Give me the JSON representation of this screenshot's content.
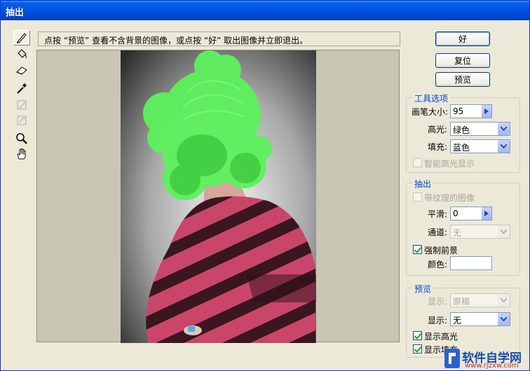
{
  "window": {
    "title": "抽出"
  },
  "hint": "点按 “预览” 查看不含背景的图像，或点按 “好” 取出图像并立即退出。",
  "tools": [
    "edge-highlighter-icon",
    "fill-bucket-icon",
    "eraser-icon",
    "eyedropper-icon",
    "cleanup-icon",
    "edge-touchup-icon",
    "zoom-icon",
    "hand-icon"
  ],
  "buttons": {
    "ok": "好",
    "reset": "复位",
    "preview": "预览"
  },
  "tool_options": {
    "title": "工具选项",
    "brush_size_label": "画笔大小:",
    "brush_size_value": "95",
    "highlight_label": "高光:",
    "highlight_value": "绿色",
    "fill_label": "填充:",
    "fill_value": "蓝色",
    "smart_highlight_label": "智能高光显示"
  },
  "extraction": {
    "title": "抽出",
    "textured_label": "带纹理的图像",
    "smooth_label": "平滑:",
    "smooth_value": "0",
    "channel_label": "通道:",
    "channel_value": "无",
    "force_fg_label": "强制前景",
    "color_label": "颜色:"
  },
  "preview_group": {
    "title": "预览",
    "show_label": "显示:",
    "show_value": "原稿",
    "show2_label": "显示:",
    "show2_value": "无",
    "show_highlight_label": "显示高光",
    "show_fill_label": "显示填充"
  },
  "watermark": {
    "text": "软件自学网",
    "url": "www.rjzxw.com"
  },
  "colors": {
    "highlight": "#5CF25C",
    "title_bar": "#0054E3",
    "group_title": "#0046D5"
  }
}
